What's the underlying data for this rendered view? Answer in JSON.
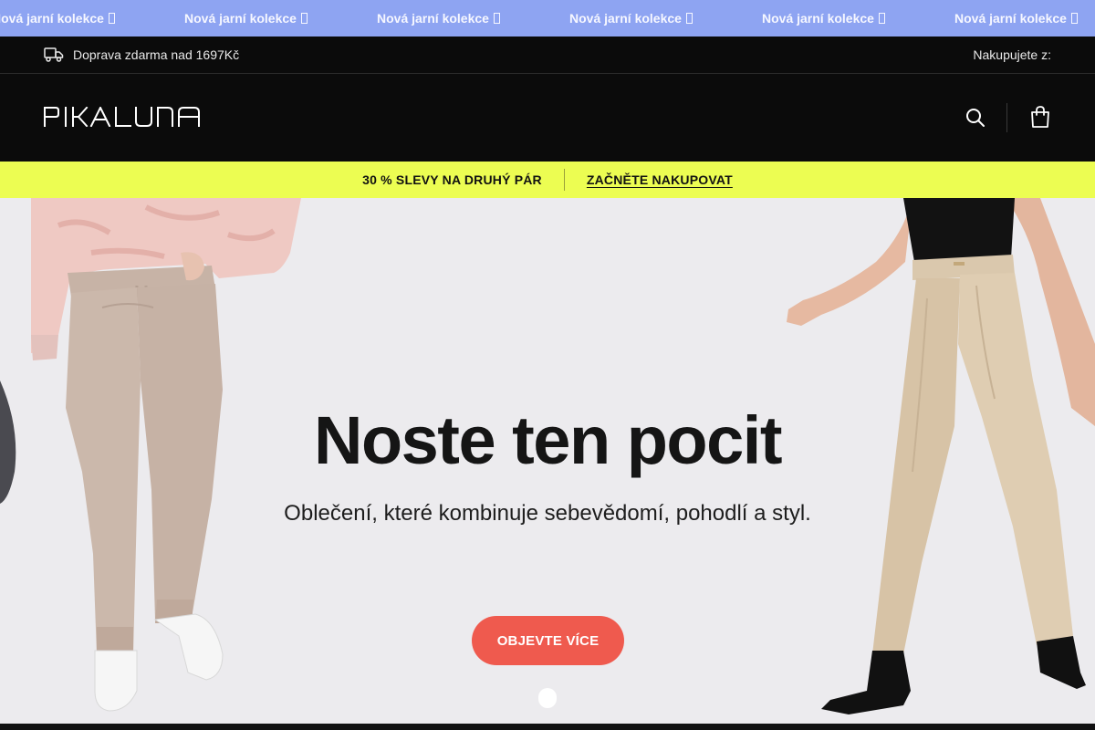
{
  "marquee": {
    "items": [
      "Nová jarní kolekce",
      "Nová jarní kolekce",
      "Nová jarní kolekce",
      "Nová jarní kolekce",
      "Nová jarní kolekce",
      "Nová jarní kolekce"
    ]
  },
  "infobar": {
    "shipping_text": "Doprava zdarma nad 1697Kč",
    "shipping_icon": "truck-icon",
    "shopping_from_label": "Nakupujete z:"
  },
  "header": {
    "logo_text": "PIKALUNA",
    "search_icon": "search-icon",
    "cart_icon": "shopping-bag-icon"
  },
  "promo": {
    "text": "30 % SLEVY NA DRUHÝ PÁR",
    "link_label": "ZAČNĚTE NAKUPOVAT"
  },
  "hero": {
    "title": "Noste ten pocit",
    "subtitle": "Oblečení, které kombinuje sebevědomí, pohodlí a styl.",
    "cta_label": "OBJEVTE VÍCE"
  },
  "colors": {
    "marquee_bg": "#8ea4f2",
    "header_bg": "#0b0b0b",
    "promo_bg": "#ecfd52",
    "hero_bg": "#ecebee",
    "cta_bg": "#ef5a4e"
  }
}
